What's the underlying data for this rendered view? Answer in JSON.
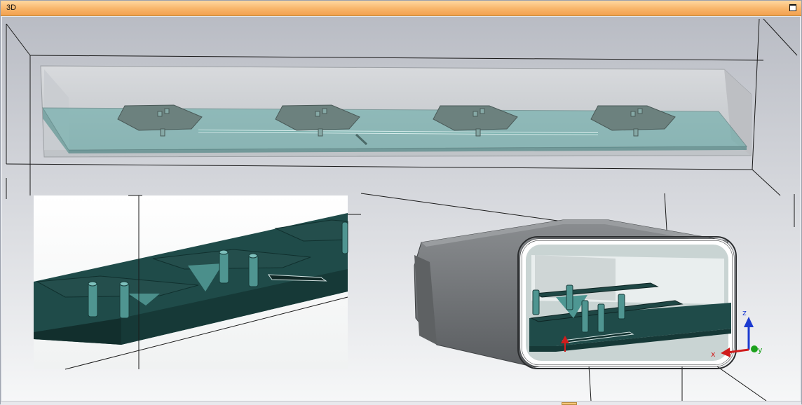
{
  "window": {
    "title": "3D"
  },
  "axes": {
    "x_label": "x",
    "y_label": "y",
    "z_label": "z",
    "x_color": "#d01c1c",
    "y_color": "#1ca11c",
    "z_color": "#1c3bd0"
  },
  "colors": {
    "titlebar_accent": "#f5a850",
    "substrate": "#5f9f9c",
    "substrate_dark": "#1f4a48",
    "patch": "#6a7f7c",
    "housing": "#6c6f72"
  }
}
